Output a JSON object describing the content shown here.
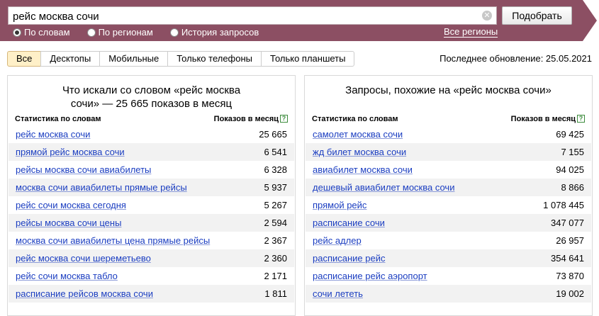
{
  "search": {
    "query": "рейс москва сочи",
    "clear_icon": "✕",
    "submit_label": "Подобрать",
    "modes": [
      {
        "label": "По словам",
        "selected": true
      },
      {
        "label": "По регионам",
        "selected": false
      },
      {
        "label": "История запросов",
        "selected": false
      }
    ],
    "regions_link": "Все регионы"
  },
  "device_tabs": [
    {
      "label": "Все",
      "active": true
    },
    {
      "label": "Десктопы",
      "active": false
    },
    {
      "label": "Мобильные",
      "active": false
    },
    {
      "label": "Только телефоны",
      "active": false
    },
    {
      "label": "Только планшеты",
      "active": false
    }
  ],
  "last_update": "Последнее обновление: 25.05.2021",
  "left_panel": {
    "title_line1": "Что искали со словом «рейс москва",
    "title_line2": "сочи» — 25 665 показов в месяц",
    "col_phrase": "Статистика по словам",
    "col_count": "Показов в месяц",
    "help_icon": "?",
    "rows": [
      {
        "phrase": "рейс москва сочи",
        "count": "25 665"
      },
      {
        "phrase": "прямой рейс москва сочи",
        "count": "6 541"
      },
      {
        "phrase": "рейсы москва сочи авиабилеты",
        "count": "6 328"
      },
      {
        "phrase": "москва сочи авиабилеты прямые рейсы",
        "count": "5 937"
      },
      {
        "phrase": "рейс сочи москва сегодня",
        "count": "5 267"
      },
      {
        "phrase": "рейсы москва сочи цены",
        "count": "2 594"
      },
      {
        "phrase": "москва сочи авиабилеты цена прямые рейсы",
        "count": "2 367"
      },
      {
        "phrase": "рейс москва сочи шереметьево",
        "count": "2 360"
      },
      {
        "phrase": "рейс сочи москва табло",
        "count": "2 171"
      },
      {
        "phrase": "расписание рейсов москва сочи",
        "count": "1 811"
      }
    ]
  },
  "right_panel": {
    "title": "Запросы, похожие на «рейс москва сочи»",
    "col_phrase": "Статистика по словам",
    "col_count": "Показов в месяц",
    "help_icon": "?",
    "rows": [
      {
        "phrase": "самолет москва сочи",
        "count": "69 425"
      },
      {
        "phrase": "жд билет москва сочи",
        "count": "7 155"
      },
      {
        "phrase": "авиабилет москва сочи",
        "count": "94 025"
      },
      {
        "phrase": "дешевый авиабилет москва сочи",
        "count": "8 866"
      },
      {
        "phrase": "прямой рейс",
        "count": "1 078 445"
      },
      {
        "phrase": "расписание сочи",
        "count": "347 077"
      },
      {
        "phrase": "рейс адлер",
        "count": "26 957"
      },
      {
        "phrase": "расписание рейс",
        "count": "354 641"
      },
      {
        "phrase": "расписание рейс аэропорт",
        "count": "73 870"
      },
      {
        "phrase": "сочи лететь",
        "count": "19 002"
      }
    ]
  },
  "colors": {
    "band": "#8c4f63",
    "link": "#1a3dc1",
    "active_tab": "#fff0c8"
  }
}
